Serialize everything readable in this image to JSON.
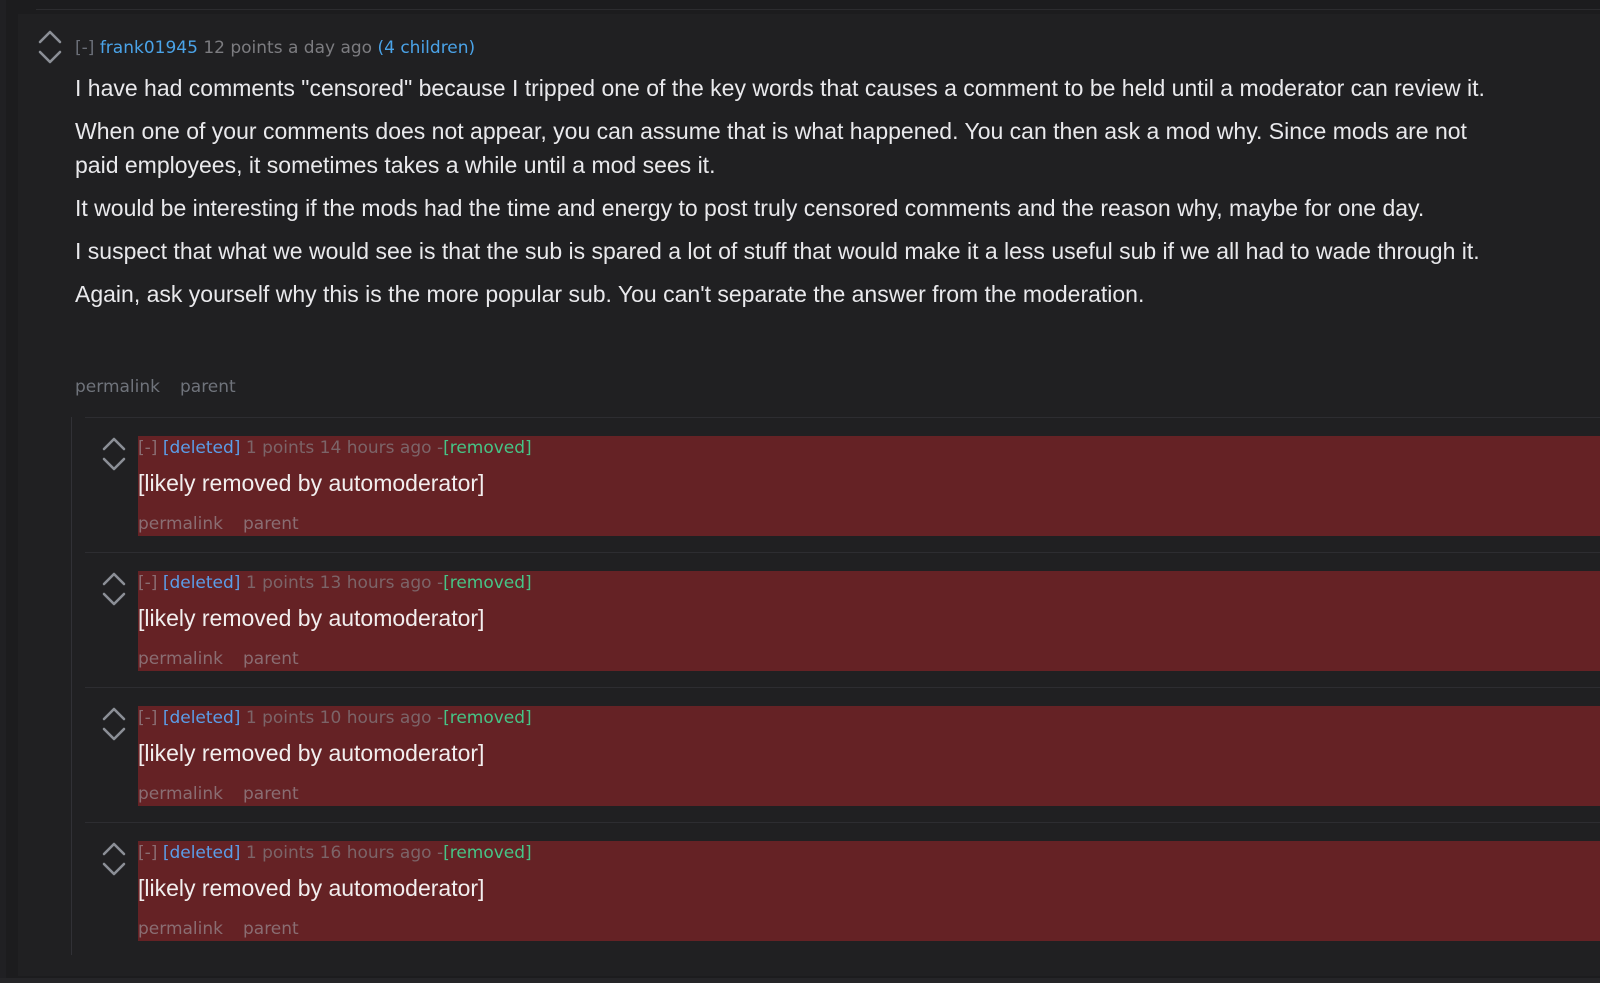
{
  "comment": {
    "toggle": "[-]",
    "author": "frank01945",
    "score_time": "12 points a day ago",
    "children": "(4 children)",
    "paragraphs": [
      "I have had comments \"censored\" because I tripped one of the key words that causes a comment to be held until a moderator can review it.",
      "When one of your comments does not appear, you can assume that is what happened. You can then ask a mod why. Since mods are not paid employees, it sometimes takes a while until a mod sees it.",
      "It would be interesting if the mods had the time and energy to post truly censored comments and the reason why, maybe for one day.",
      "I suspect that what we would see is that the sub is spared a lot of stuff that would make it a less useful sub if we all had to wade through it.",
      "Again, ask yourself why this is the more popular sub. You can't separate the answer from the moderation."
    ],
    "permalink": "permalink",
    "parent": "parent"
  },
  "replies": [
    {
      "toggle": "[-]",
      "author": "[deleted]",
      "score_time": "1 points 14 hours ago",
      "dash": "-",
      "status": "[removed]",
      "body": "[likely removed by automoderator]",
      "permalink": "permalink",
      "parent": "parent"
    },
    {
      "toggle": "[-]",
      "author": "[deleted]",
      "score_time": "1 points 13 hours ago",
      "dash": "-",
      "status": "[removed]",
      "body": "[likely removed by automoderator]",
      "permalink": "permalink",
      "parent": "parent"
    },
    {
      "toggle": "[-]",
      "author": "[deleted]",
      "score_time": "1 points 10 hours ago",
      "dash": "-",
      "status": "[removed]",
      "body": "[likely removed by automoderator]",
      "permalink": "permalink",
      "parent": "parent"
    },
    {
      "toggle": "[-]",
      "author": "[deleted]",
      "score_time": "1 points 16 hours ago",
      "dash": "-",
      "status": "[removed]",
      "body": "[likely removed by automoderator]",
      "permalink": "permalink",
      "parent": "parent"
    }
  ],
  "icons": {
    "upvote": "upvote-arrow-icon",
    "downvote": "downvote-arrow-icon"
  },
  "colors": {
    "background": "#1c1c1e",
    "comment_background": "#202022",
    "removed_background": "#652225",
    "author_link": "#4aa3e8",
    "removed_status": "#46c486",
    "body_text": "#e9e9ec"
  }
}
